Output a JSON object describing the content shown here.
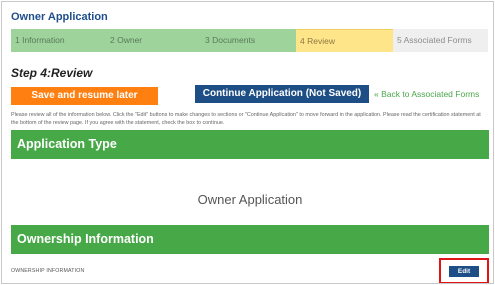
{
  "app": {
    "title": "Owner Application"
  },
  "wizard": {
    "steps": [
      {
        "label": "1  Information",
        "state": "done"
      },
      {
        "label": "2  Owner",
        "state": "done"
      },
      {
        "label": "3  Documents",
        "state": "done"
      },
      {
        "label": "4  Review",
        "state": "active"
      },
      {
        "label": "5  Associated Forms",
        "state": "todo"
      }
    ]
  },
  "page": {
    "step_title": "Step 4:Review",
    "instructions": "Please review all of the information below. Click the \"Edit\" buttons to make changes to sections or \"Continue Application\" to move forward in the application. Please read the certification statement at the bottom of the review page. If you agree with the statement, check the box to continue."
  },
  "actions": {
    "save_label": "Save and resume later",
    "continue_label": "Continue Application (Not Saved)",
    "back_label": "« Back to Associated Forms"
  },
  "sections": {
    "application_type": "Application Type",
    "application_name": "Owner Application",
    "ownership": "Ownership Information",
    "ownership_sub": "OWNERSHIP INFORMATION",
    "edit_label": "Edit"
  },
  "colors": {
    "title_blue": "#1f4e8c",
    "section_green": "#47a847",
    "save_orange": "#ff7f11",
    "continue_navy": "#1d4e86",
    "highlight_red": "#e01616",
    "active_step_yellow": "#ffe58a"
  }
}
